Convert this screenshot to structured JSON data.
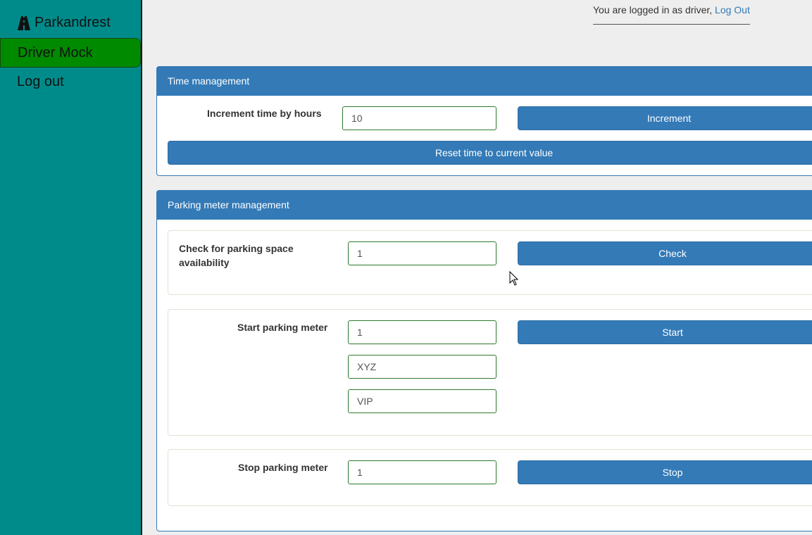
{
  "sidebar": {
    "brand": "Parkandrest",
    "items": [
      {
        "label": "Driver Mock"
      },
      {
        "label": "Log out"
      }
    ]
  },
  "header": {
    "login_text": "You are logged in as driver,",
    "logout_link": "Log Out"
  },
  "time_management": {
    "title": "Time management",
    "increment_label": "Increment time by hours",
    "increment_value": "10",
    "increment_button": "Increment",
    "reset_button": "Reset time to current value"
  },
  "parking_meter_management": {
    "title": "Parking meter management",
    "check": {
      "label": "Check for parking space availability",
      "value": "1",
      "button": "Check"
    },
    "start": {
      "label": "Start parking meter",
      "space_value": "1",
      "plate_value": "XYZ",
      "type_value": "VIP",
      "button": "Start"
    },
    "stop": {
      "label": "Stop parking meter",
      "value": "1",
      "button": "Stop"
    }
  },
  "colors": {
    "sidebar_bg": "#008b8b",
    "active_item_bg": "#008a00",
    "panel_primary": "#337ab7",
    "input_border": "#2d7a2d"
  }
}
